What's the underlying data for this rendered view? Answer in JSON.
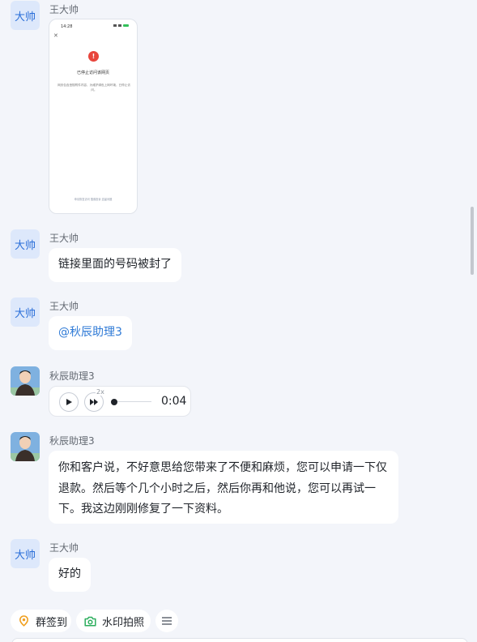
{
  "messages": [
    {
      "sender": "王大帅",
      "avatar_text": "大帅",
      "type": "image",
      "phone": {
        "time": "14:28",
        "title": "已停止访问该网页",
        "desc": "网页包含违规附件内容，为维护绿色上网环境，已停止访问。",
        "footer": "申请恢复访问   搜索投诉   遗留问题"
      }
    },
    {
      "sender": "王大帅",
      "avatar_text": "大帅",
      "type": "text",
      "text": "链接里面的号码被封了"
    },
    {
      "sender": "王大帅",
      "avatar_text": "大帅",
      "type": "mention",
      "text": "@秋辰助理3"
    },
    {
      "sender": "秋辰助理3",
      "type": "voice",
      "speed": "2x",
      "duration": "0:04",
      "progress": 0
    },
    {
      "sender": "秋辰助理3",
      "type": "text",
      "lines": [
        "你和客户说，不好意思给您带来了不便和麻烦，您可以申请一下仅",
        "退款。然后等个几个小时之后，然后你再和他说，您可以再试一",
        "下。我这边刚刚修复了一下资料。"
      ]
    },
    {
      "sender": "王大帅",
      "avatar_text": "大帅",
      "type": "text",
      "text": "好的"
    }
  ],
  "toolbar": {
    "checkin_label": "群签到",
    "photo_label": "水印拍照",
    "icons": [
      "location-pin-icon",
      "camera-icon",
      "menu-icon"
    ]
  },
  "colors": {
    "accent": "#2f7ad6",
    "avatar_bg": "#dde8fb",
    "bubble": "#ffffff",
    "background": "#f3f5fa",
    "checkin_icon": "#f0a020",
    "camera_icon": "#2cae5d"
  }
}
